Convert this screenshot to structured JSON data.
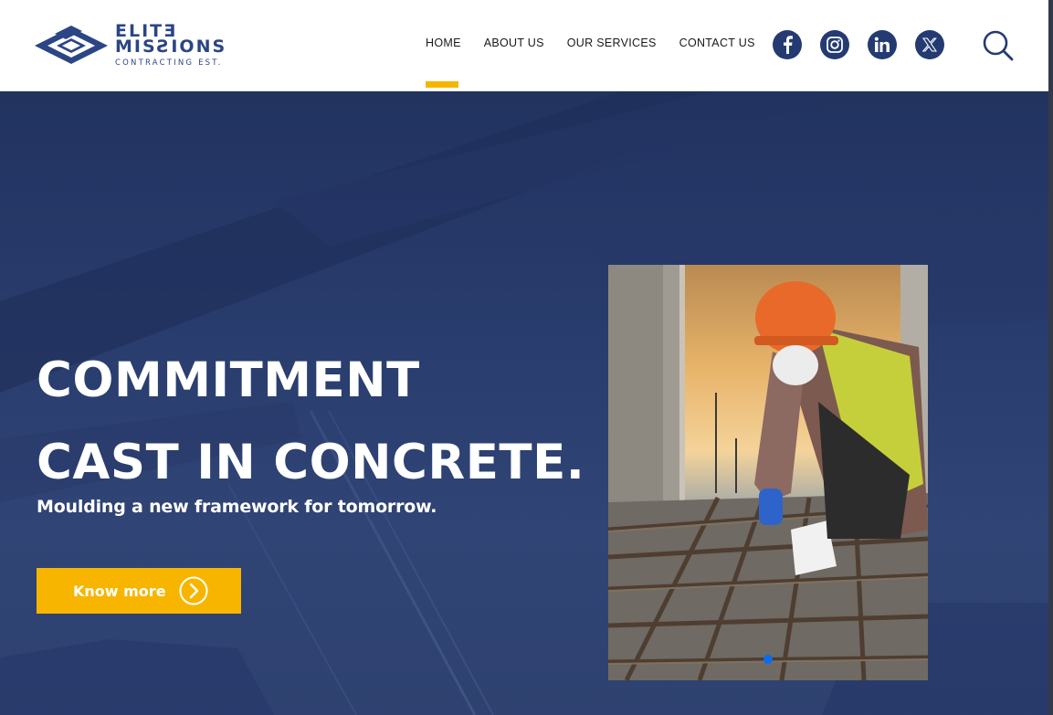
{
  "brand": {
    "logo_line1": "ELITƎ",
    "logo_line2": "MISƧIONS",
    "logo_line3": "CONTRACTING EST.",
    "colors": {
      "primary": "#243a72",
      "accent": "#f7b500",
      "text": "#1a1a1a"
    }
  },
  "nav": {
    "items": [
      {
        "label": "HOME",
        "active": true
      },
      {
        "label": "ABOUT US"
      },
      {
        "label": "OUR SERVICES"
      },
      {
        "label": "CONTACT US"
      }
    ]
  },
  "social": [
    "facebook-icon",
    "instagram-icon",
    "linkedin-icon",
    "x-icon"
  ],
  "search": {
    "icon": "search-icon"
  },
  "hero": {
    "title_line1": "COMMITMENT",
    "title_line2": "CAST IN CONCRETE.",
    "subtitle": "Moulding a new framework for tomorrow.",
    "cta_label": "Know more",
    "cta_icon": "chevron-right-circle-icon",
    "photo": "construction-worker-rebar-photo",
    "slider": {
      "current": 1
    }
  }
}
